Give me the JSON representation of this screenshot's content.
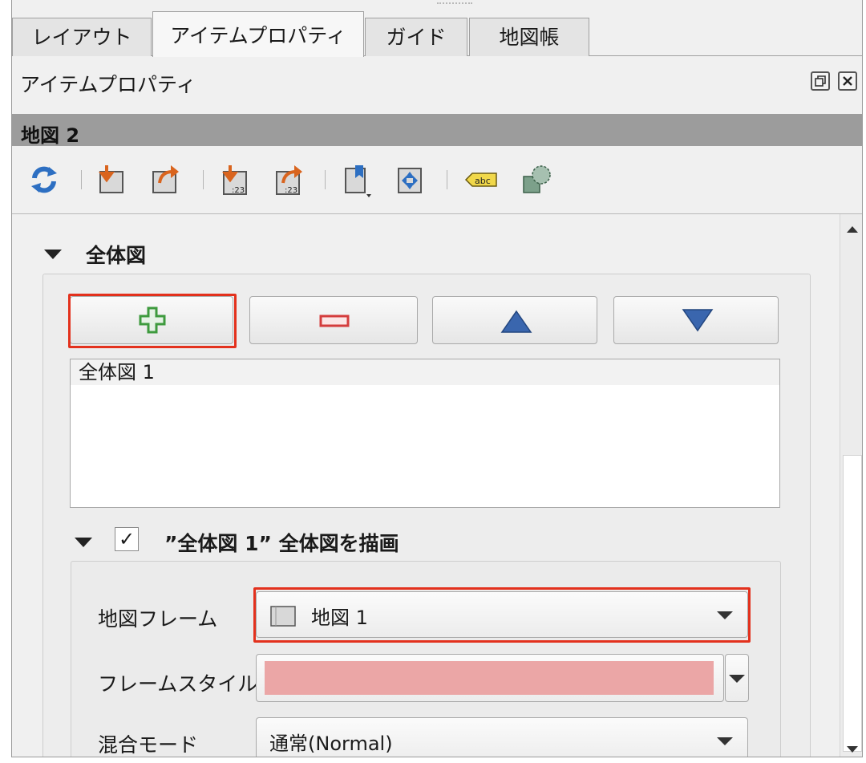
{
  "tabs": [
    {
      "label": "レイアウト",
      "active": false
    },
    {
      "label": "アイテムプロパティ",
      "active": true
    },
    {
      "label": "ガイド",
      "active": false
    },
    {
      "label": "地図帳",
      "active": false
    }
  ],
  "dock": {
    "title": "アイテムプロパティ",
    "float_icon": "float-icon",
    "close_icon": "close-icon"
  },
  "item": {
    "name": "地図 2"
  },
  "toolbar": {
    "icons": [
      "refresh-icon",
      "set-extent-from-canvas-icon",
      "view-extent-in-canvas-icon",
      "set-scale-from-canvas-icon",
      "set-canvas-scale-icon",
      "bookmark-icon",
      "set-extent-to-item-icon",
      "label-settings-icon",
      "clipping-icon"
    ],
    "label_icon_text": "abc"
  },
  "overview": {
    "section_title": "全体図",
    "buttons": {
      "add_icon": "plus-icon",
      "remove_icon": "minus-icon",
      "up_icon": "triangle-up-icon",
      "down_icon": "triangle-down-icon"
    },
    "items": [
      "全体図 1"
    ],
    "sub_section_title": "”全体図 1” 全体図を描画",
    "checkbox_checked": true,
    "checkbox_mark": "✓"
  },
  "properties": {
    "map_frame_label": "地図フレーム",
    "map_frame_value": "地図 1",
    "frame_style_label": "フレームスタイル",
    "frame_style_color": "#eba6a6",
    "blend_mode_label": "混合モード",
    "blend_mode_value": "通常(Normal)"
  },
  "colors": {
    "highlight": "#e3311d",
    "plus": "#3e9a3e",
    "minus": "#d43c3c",
    "arrow_blue": "#3a66ae"
  }
}
